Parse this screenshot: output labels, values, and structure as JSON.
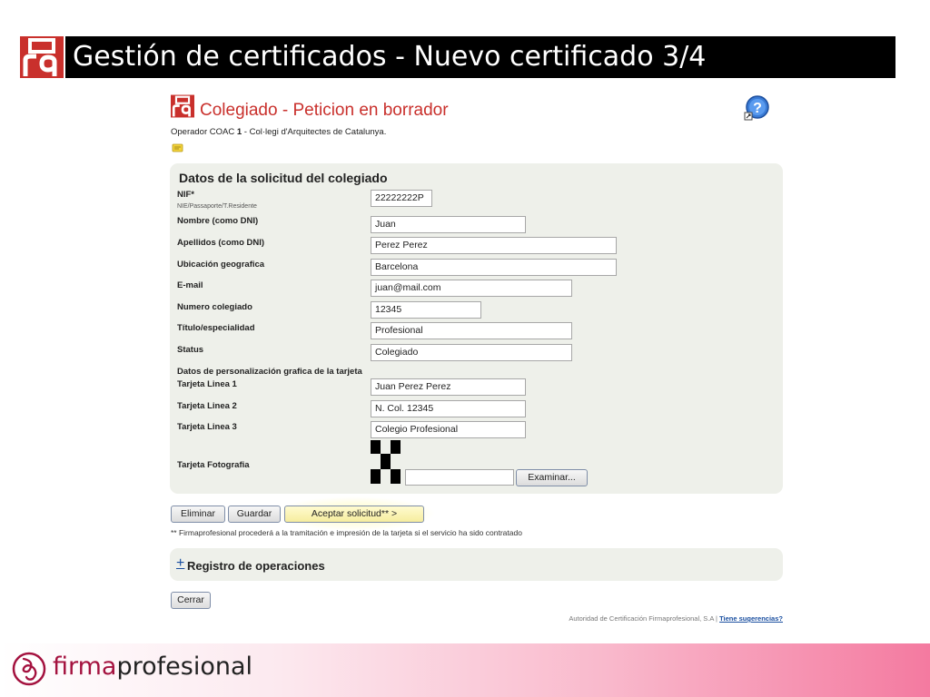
{
  "slide": {
    "title": "Gestión de certificados - Nuevo certificado 3/4"
  },
  "app": {
    "title": "Colegiado - Peticion en borrador",
    "operator_prefix": "Operador COAC ",
    "operator_bold": "1",
    "operator_suffix": " - Col·legi d'Arquitectes de Catalunya."
  },
  "form": {
    "section_title": "Datos de la solicitud del colegiado",
    "nif": {
      "label": "NIF*",
      "sublabel": "NIE/Passaporte/T.Residente",
      "value": "22222222P"
    },
    "nombre": {
      "label": "Nombre (como DNI)",
      "value": "Juan"
    },
    "apellidos": {
      "label": "Apellidos (como DNI)",
      "value": "Perez Perez"
    },
    "ubicacion": {
      "label": "Ubicación geografica",
      "value": "Barcelona"
    },
    "email": {
      "label": "E-mail",
      "value": "juan@mail.com"
    },
    "numero": {
      "label": "Numero colegiado",
      "value": "12345"
    },
    "titulo": {
      "label": "Título/especialidad",
      "value": "Profesional"
    },
    "status": {
      "label": "Status",
      "value": "Colegiado"
    },
    "personalizacion_title": "Datos de personalización grafica de la tarjeta",
    "linea1": {
      "label": "Tarjeta Linea 1",
      "value": "Juan Perez Perez"
    },
    "linea2": {
      "label": "Tarjeta Linea 2",
      "value": "N. Col. 12345"
    },
    "linea3": {
      "label": "Tarjeta Linea 3",
      "value": "Colegio Profesional"
    },
    "foto": {
      "label": "Tarjeta Fotografia",
      "button": "Examinar..."
    }
  },
  "actions": {
    "eliminar": "Eliminar",
    "guardar": "Guardar",
    "aceptar": "Aceptar solicitud** >",
    "footnote": "** Firmaprofesional procederá a la tramitación e impresión de la tarjeta si el servicio ha sido contratado"
  },
  "registro": {
    "plus": "+",
    "title": "Registro de operaciones"
  },
  "cerrar": "Cerrar",
  "credit": {
    "text": "Autoridad de Certificación Firmaprofesional, S.A | ",
    "link": "Tiene sugerencias?"
  },
  "brand": {
    "part1": "firma",
    "part2": "profesional"
  },
  "colors": {
    "brand": "#a4123f",
    "title_red": "#c9302c",
    "link": "#1a4fa0"
  }
}
